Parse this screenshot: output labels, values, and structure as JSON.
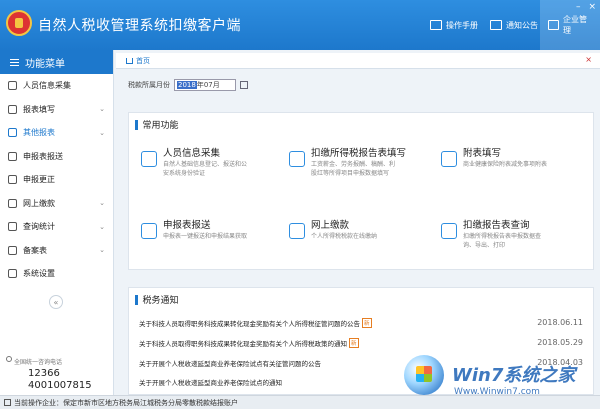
{
  "header": {
    "title": "自然人税收管理系统扣缴客户端",
    "manual": "操作手册",
    "notice": "通知公告",
    "center": "企业管理",
    "min": "–",
    "close": "×"
  },
  "sidebar": {
    "title": "功能菜单",
    "items": [
      {
        "label": "人员信息采集"
      },
      {
        "label": "报表填写"
      },
      {
        "label": "其他报表"
      },
      {
        "label": "申报表报送"
      },
      {
        "label": "申报更正"
      },
      {
        "label": "网上缴款"
      },
      {
        "label": "查询统计"
      },
      {
        "label": "备案表"
      },
      {
        "label": "系统设置"
      }
    ],
    "collapse": "«",
    "hotline_label": "全国统一咨询电话",
    "hotline_1": "12366",
    "hotline_2": "4001007815"
  },
  "tabs": {
    "home": "首页",
    "close": "×"
  },
  "filter": {
    "label": "税款所属月份",
    "value_year": "2018",
    "value_month": "年07月"
  },
  "common": {
    "title": "常用功能",
    "items": [
      {
        "title": "人员信息采集",
        "desc": "自然人基础信息登记、报送和公安系统身份验证"
      },
      {
        "title": "扣缴所得税报告表填写",
        "desc": "工资薪金、劳务报酬、稿酬、利股红等所得项目申报数据填写"
      },
      {
        "title": "附表填写",
        "desc": "商业健康保险附表减免事项附表"
      },
      {
        "title": "申报表报送",
        "desc": "申报表一键报送和申报结果获取"
      },
      {
        "title": "网上缴款",
        "desc": "个人所得税税款在线缴纳"
      },
      {
        "title": "扣缴报告表查询",
        "desc": "扣缴所得税报告表申报数据查询、导出、打印"
      }
    ]
  },
  "notices": {
    "title": "税务通知",
    "new_label": "新",
    "items": [
      {
        "text": "关于科技人员取得职务科技成果转化现金奖励有关个人所得税征管问题的公告",
        "date": "2018.06.11",
        "new": true
      },
      {
        "text": "关于科技人员取得职务科技成果转化现金奖励有关个人所得税政策的通知",
        "date": "2018.05.29",
        "new": true
      },
      {
        "text": "关于开展个人税收递延型商业养老保险试点有关征管问题的公告",
        "date": "2018.04.03",
        "new": false
      },
      {
        "text": "关于开展个人税收递延型商业养老保险试点的通知",
        "date": "",
        "new": false
      }
    ]
  },
  "statusbar": {
    "text": "当前操作企业：保定市新市区地方税务局江城税务分局零散税款结报账户"
  },
  "watermark": {
    "brand": "Win7系统之家",
    "url": "Www.Winwin7.com"
  }
}
